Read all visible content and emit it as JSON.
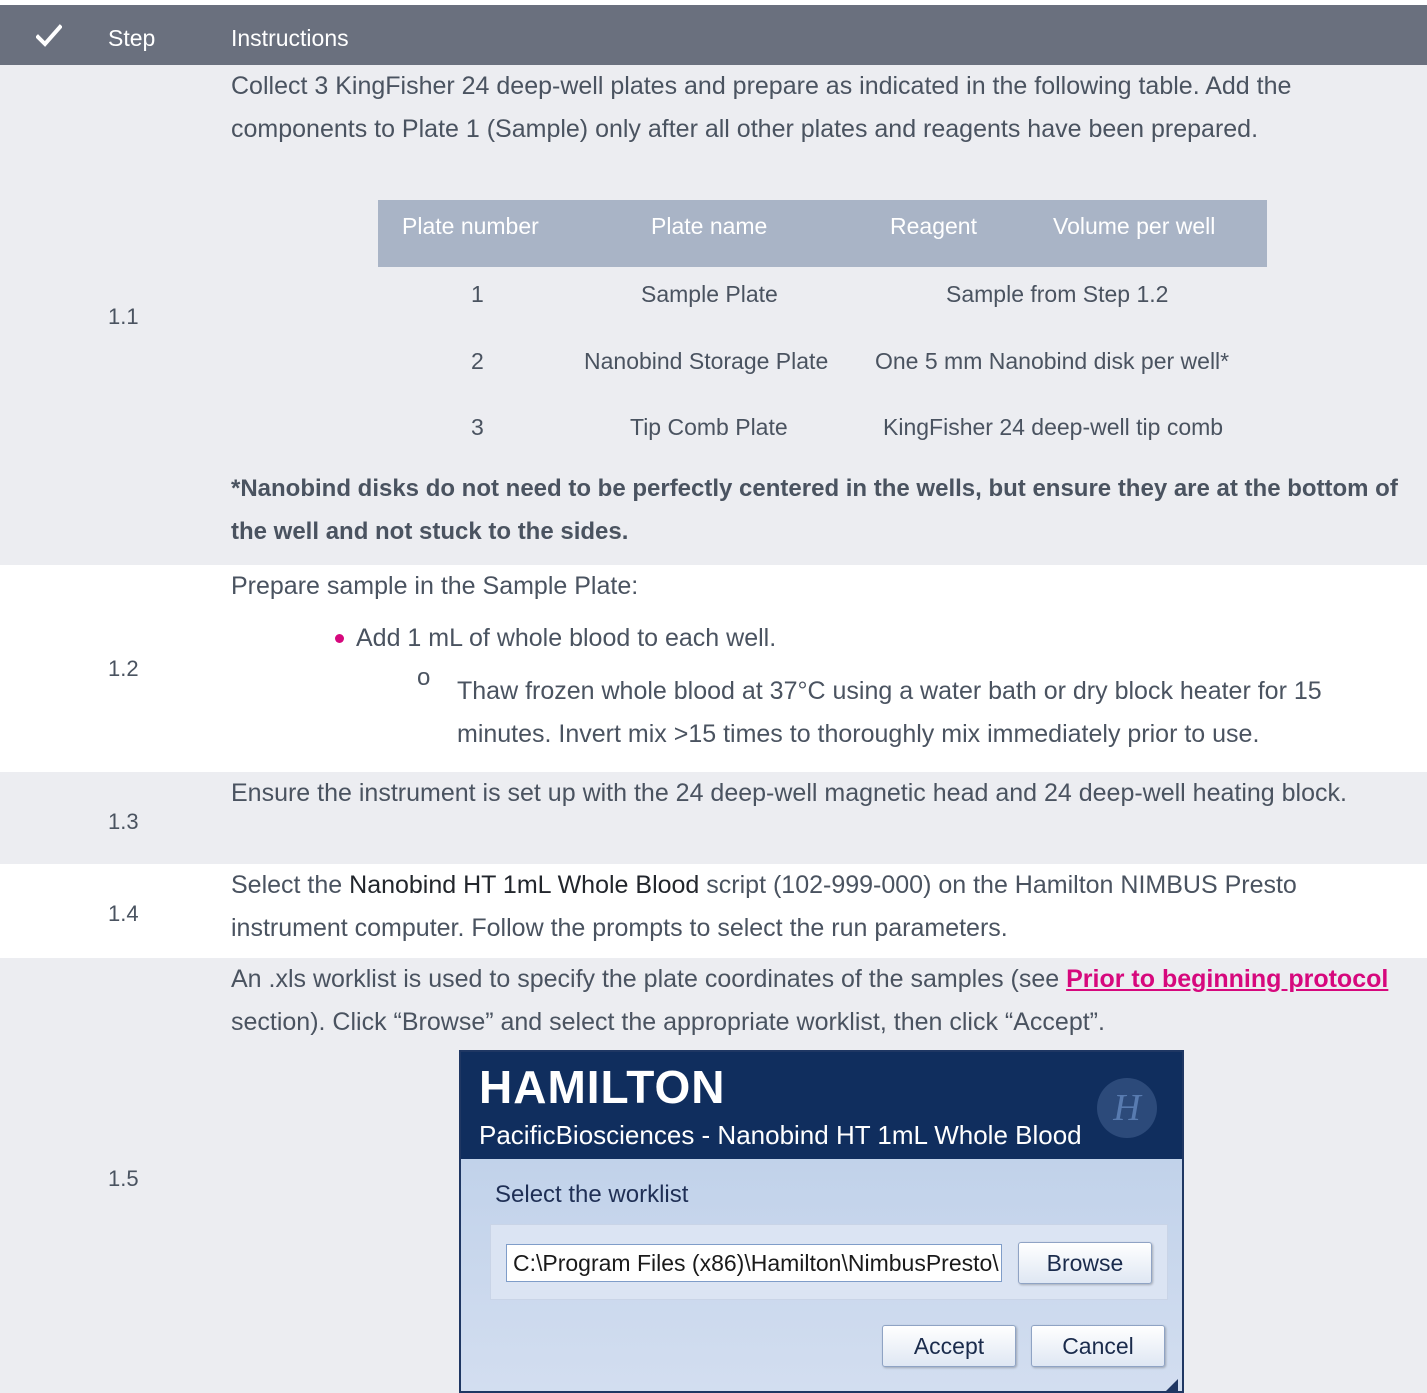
{
  "header": {
    "step": "Step",
    "instructions": "Instructions"
  },
  "steps": {
    "s11": {
      "num": "1.1",
      "intro": "Collect 3 KingFisher 24 deep-well plates and prepare as indicated in the following table. Add the components to Plate 1 (Sample) only after all other plates and reagents have been prepared.",
      "table": {
        "headers": [
          "Plate number",
          "Plate name",
          "Reagent",
          "Volume per well"
        ],
        "rows": [
          {
            "num": "1",
            "name": "Sample Plate",
            "reagent": "Sample from Step 1.2"
          },
          {
            "num": "2",
            "name": "Nanobind Storage Plate",
            "reagent": "One 5 mm Nanobind disk per well*"
          },
          {
            "num": "3",
            "name": "Tip Comb Plate",
            "reagent": "KingFisher 24 deep-well tip comb"
          }
        ]
      },
      "note": "*Nanobind disks do not need to be perfectly centered in the wells, but ensure they are at the bottom of the well and not stuck to the sides."
    },
    "s12": {
      "num": "1.2",
      "intro": "Prepare sample in the Sample Plate:",
      "bullet": "Add 1 mL of whole blood to each well.",
      "subbullet": "Thaw frozen whole blood at 37°C using a water bath or dry block heater for 15 minutes. Invert mix >15 times to thoroughly mix immediately prior to use."
    },
    "s13": {
      "num": "1.3",
      "text": "Ensure the instrument is set up with the 24 deep-well magnetic head and 24 deep-well heating block."
    },
    "s14": {
      "num": "1.4",
      "pre": "Select the ",
      "bold": "Nanobind HT 1mL Whole Blood",
      "post": " script (102-999-000) on the Hamilton NIMBUS Presto instrument computer. Follow the prompts to select the run parameters."
    },
    "s15": {
      "num": "1.5",
      "pre": "An .xls worklist is used to specify the plate coordinates of the samples (see ",
      "link": "Prior to beginning protocol",
      "post": " section). Click “Browse” and select the appropriate worklist, then click “Accept”."
    }
  },
  "dialog": {
    "brand": "HAMILTON",
    "subtitle": "PacificBiosciences - Nanobind HT 1mL Whole Blood",
    "label": "Select the worklist",
    "path": "C:\\Program Files (x86)\\Hamilton\\NimbusPresto\\",
    "browse": "Browse",
    "accept": "Accept",
    "cancel": "Cancel"
  }
}
